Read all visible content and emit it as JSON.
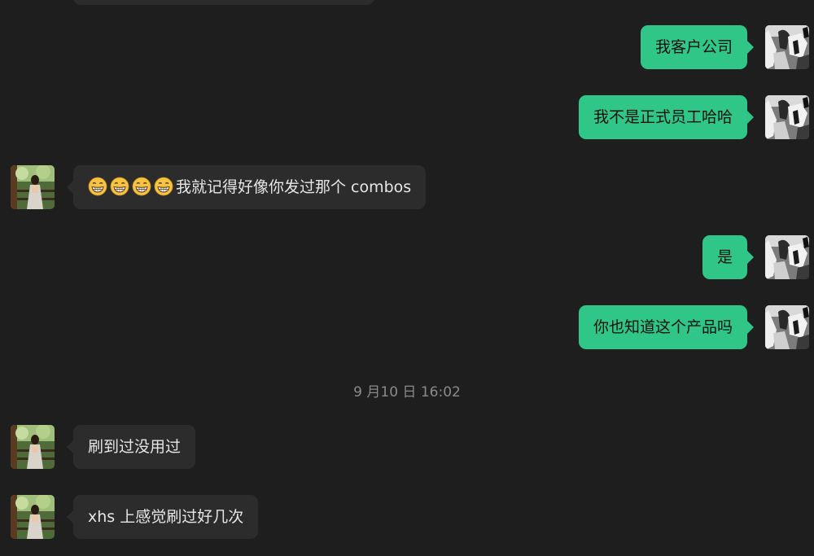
{
  "timestamp": "9 月10 日 16:02",
  "messages": {
    "m1": "我客户公司",
    "m2": "我不是正式员工哈哈",
    "m3_text": "我就记得好像你发过那个 combos",
    "m3_emoji_count": 4,
    "m4": "是",
    "m5": "你也知道这个产品吗",
    "m6": "刷到过没用过",
    "m7": "xhs 上感觉刷过好几次"
  },
  "colors": {
    "background": "#1e1e1e",
    "incoming_bubble": "#2c2c2c",
    "outgoing_bubble": "#2fc687",
    "timestamp_text": "#8a8a8a"
  },
  "icons": {
    "emoji": "grinning-face-emoji",
    "self_avatar": "grayscale-photo-avatar",
    "contact_avatar": "forest-portrait-avatar"
  }
}
